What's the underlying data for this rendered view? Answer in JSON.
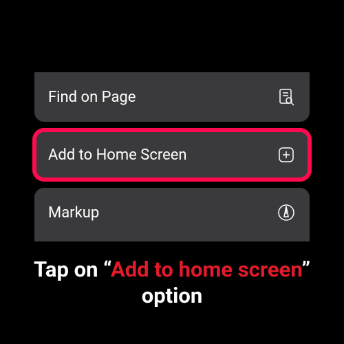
{
  "menu": {
    "items": [
      {
        "label": "Find on Page",
        "icon": "find-on-page-icon"
      },
      {
        "label": "Add to Home Screen",
        "icon": "add-to-home-icon",
        "highlighted": true
      },
      {
        "label": "Markup",
        "icon": "markup-icon"
      }
    ]
  },
  "caption": {
    "prefix": "Tap on “",
    "highlight": "Add to home screen",
    "suffix": "” option"
  },
  "colors": {
    "highlight_border": "#ff0a4f",
    "caption_highlight": "#e11b2a",
    "menu_bg": "#3a3a3c"
  }
}
